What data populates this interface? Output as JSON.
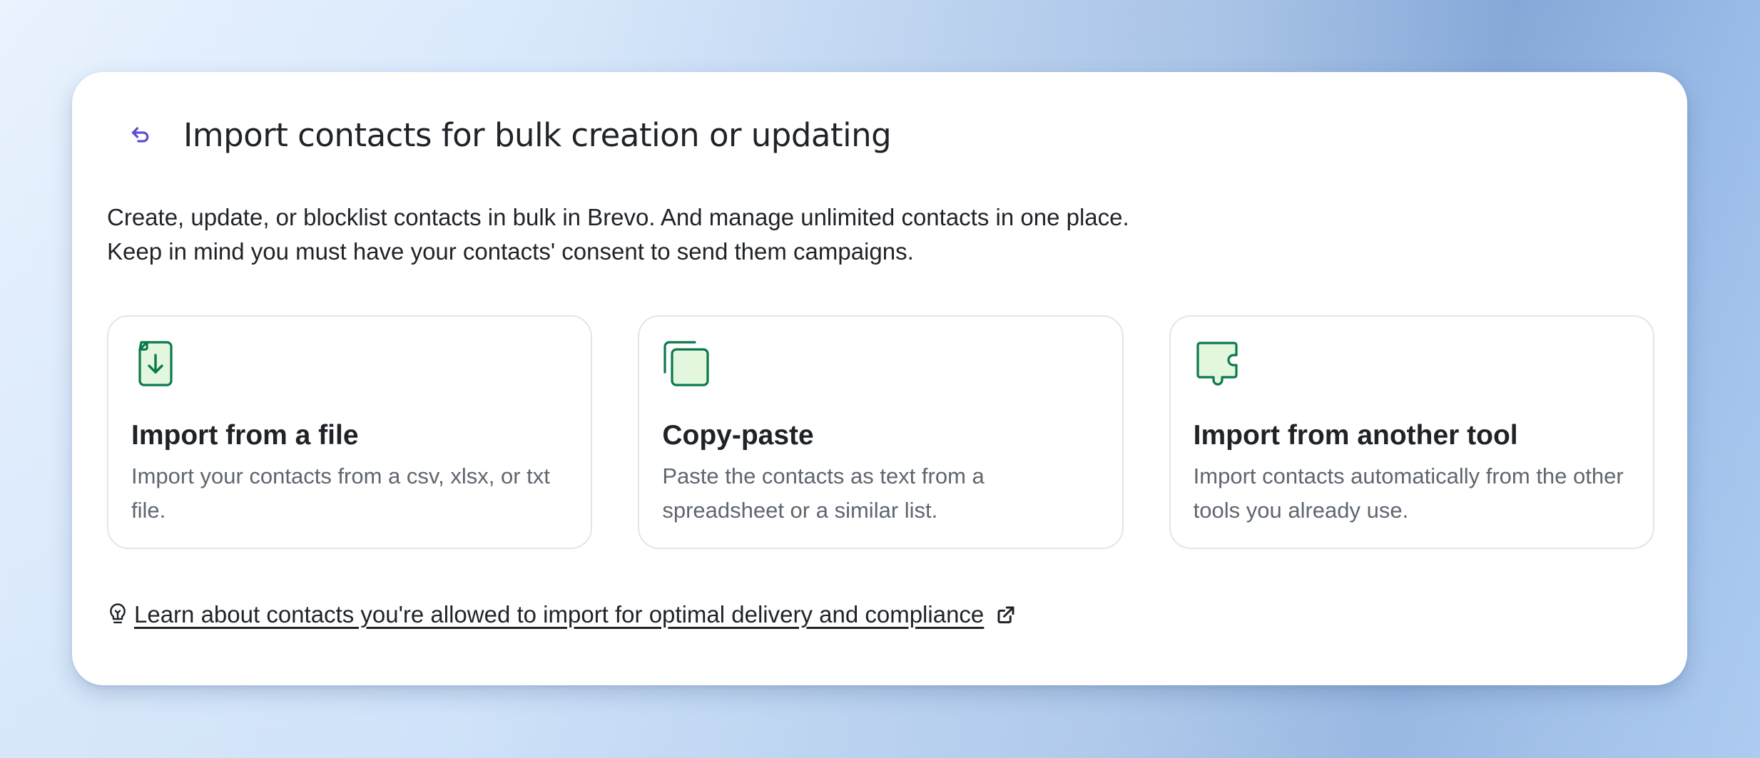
{
  "header": {
    "back_icon": "back-arrow-icon",
    "title": "Import contacts for bulk creation or updating"
  },
  "intro": {
    "line1": "Create, update, or blocklist contacts in bulk in Brevo. And manage unlimited contacts in one place.",
    "line2": "Keep in mind you must have your contacts' consent to send them campaigns."
  },
  "options": [
    {
      "icon": "file-import-icon",
      "title": "Import from a file",
      "description": "Import your contacts from a csv, xlsx, or txt file."
    },
    {
      "icon": "copy-paste-icon",
      "title": "Copy-paste",
      "description": "Paste the contacts as text from a spreadsheet or a similar list."
    },
    {
      "icon": "puzzle-icon",
      "title": "Import from another tool",
      "description": "Import contacts automatically from the other tools you already use."
    }
  ],
  "learn": {
    "icon": "lightbulb-icon",
    "link_text": "Learn about contacts you're allowed to import for optimal delivery and compliance",
    "external_icon": "external-link-icon"
  },
  "colors": {
    "accent": "#5b4fcf",
    "icon_green": "#0b7a4b",
    "icon_green_fill": "#e3f7df",
    "text_primary": "#1f2328",
    "text_secondary": "#5f6670",
    "border": "#e3e5e8"
  }
}
